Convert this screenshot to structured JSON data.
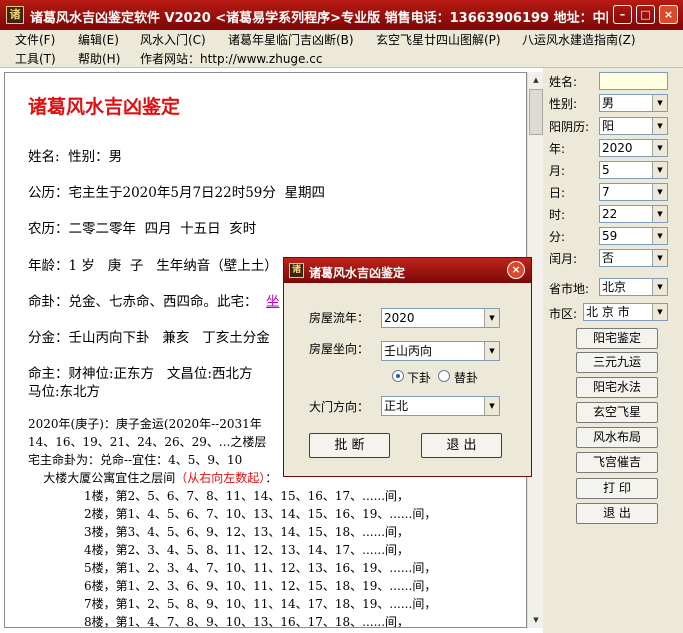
{
  "window": {
    "title": "诸葛风水吉凶鉴定软件 V2020 <诸葛易学系列程序>专业版   销售电话：13663906199   地址：中国北京",
    "icon_text": "诸",
    "min_glyph": "–",
    "max_glyph": "□",
    "close_glyph": "×"
  },
  "menu": {
    "row1": [
      "文件(F)",
      "编辑(E)",
      "风水入门(C)",
      "诸葛年星临门吉凶断(B)",
      "玄空飞星廿四山图解(P)",
      "八运风水建造指南(Z)"
    ],
    "row2": [
      "工具(T)",
      "帮助(H)",
      "作者网站：http://www.zhuge.cc"
    ]
  },
  "document": {
    "heading": "诸葛风水吉凶鉴定",
    "lines": [
      "姓名:  性别：男",
      "公历：宅主生于2020年5月7日22时59分  星期四",
      "农历：二零二零年  四月  十五日  亥时",
      "年龄：1 岁   庚  子   生年纳音（壁上土）",
      "命卦：兑金、七赤命、西四命。此宅：",
      "分金：壬山丙向下卦   兼亥   丁亥土分金",
      "命主：财神位:正东方   文昌位:西北方",
      "马位:东北方"
    ],
    "partial_link": "坐",
    "block_lines": [
      "2020年(庚子)：庚子金运(2020年--2031年",
      "14、16、19、21、24、26、29、...之楼层",
      "宅主命卦为：兑命--宜住：4、5、9、10"
    ],
    "floor_intro": "    大楼大厦公寓宜住之层间",
    "floor_intro_red": "（从右向左数起）",
    "floor_intro_end": "：",
    "floors": [
      "1楼，第2、5、6、7、8、11、14、15、16、17、......间，",
      "2楼，第1、4、5、6、7、10、13、14、15、16、19、......间，",
      "3楼，第3、4、5、6、9、12、13、14、15、18、......间，",
      "4楼，第2、3、4、5、8、11、12、13、14、17、......间，",
      "5楼，第1、2、3、4、7、10、11、12、13、16、19、......间，",
      "6楼，第1、2、3、6、9、10、11、12、15、18、19、......间，",
      "7楼，第1、2、5、8、9、10、11、14、17、18、19、......间，",
      "8楼，第1、4、7、8、9、10、13、16、17、18、......间，"
    ]
  },
  "form": {
    "name_label": "姓名:",
    "name_value": "",
    "gender_label": "性别:",
    "gender_value": "男",
    "calendar_label": "阳阴历:",
    "calendar_value": "阳",
    "year_label": "年:",
    "year_value": "2020",
    "month_label": "月:",
    "month_value": "5",
    "day_label": "日:",
    "day_value": "7",
    "hour_label": "时:",
    "hour_value": "22",
    "minute_label": "分:",
    "minute_value": "59",
    "leap_label": "闰月:",
    "leap_value": "否",
    "province_label": "省市地:",
    "province_value": "北京",
    "district_label": "市区:",
    "district_value": "北 京 市"
  },
  "buttons": [
    "阳宅鉴定",
    "三元九运",
    "阳宅水法",
    "玄空飞星",
    "风水布局",
    "飞宫催吉",
    "打 印",
    "退 出"
  ],
  "dialog": {
    "title": "诸葛风水吉凶鉴定",
    "year_label": "房屋流年：",
    "year_value": "2020",
    "facing_label": "房屋坐向：",
    "facing_value": "壬山丙向",
    "radio1": "下卦",
    "radio2": "替卦",
    "gate_label": "大门方向：",
    "gate_value": "正北",
    "ok_label": "批 断",
    "exit_label": "退 出"
  }
}
